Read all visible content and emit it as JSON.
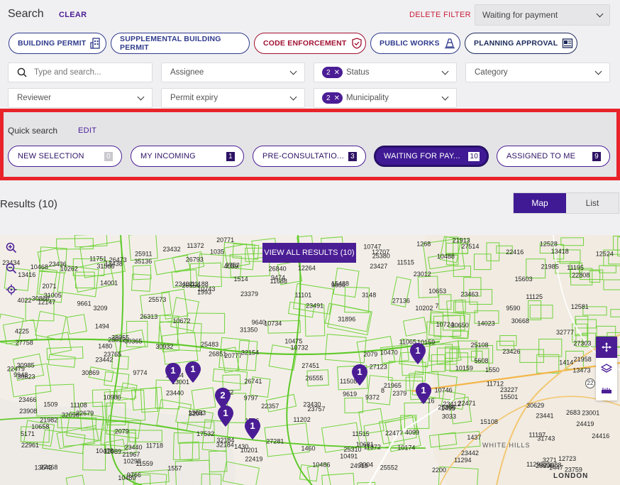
{
  "header": {
    "title": "Search",
    "clear": "CLEAR",
    "delete_filter": "DELETE FILTER",
    "saved_filter": "Waiting for payment"
  },
  "categories": [
    {
      "label": "BUILDING PERMIT",
      "icon": "building-icon"
    },
    {
      "label": "SUPPLEMENTAL BUILDING PERMIT",
      "icon": ""
    },
    {
      "label": "CODE ENFORCEMENT",
      "icon": "shield-check-icon"
    },
    {
      "label": "PUBLIC WORKS",
      "icon": "cone-icon"
    },
    {
      "label": "PLANNING APPROVAL",
      "icon": "map-icon"
    }
  ],
  "filters": {
    "search_placeholder": "Type and search...",
    "assignee": "Assignee",
    "status": {
      "count": "2",
      "label": "Status"
    },
    "category": "Category",
    "reviewer": "Reviewer",
    "permit_expiry": "Permit expiry",
    "municipality": {
      "count": "2",
      "label": "Municipality"
    }
  },
  "quick_search": {
    "title": "Quick search",
    "edit": "EDIT",
    "items": [
      {
        "label": "NEW SELECTION",
        "count": "0"
      },
      {
        "label": "MY INCOMING",
        "count": "1"
      },
      {
        "label": "PRE-CONSULTATIO...",
        "count": "3"
      },
      {
        "label": "WAITING FOR PAY...",
        "count": "10",
        "active": true
      },
      {
        "label": "ASSIGNED TO ME",
        "count": "9"
      }
    ]
  },
  "results": {
    "label": "Results (10)",
    "view_map": "Map",
    "view_list": "List"
  },
  "map": {
    "view_all": "VIEW ALL RESULTS (10)",
    "markers": [
      "1",
      "1",
      "1",
      "1",
      "1",
      "1",
      "2",
      "1",
      "1"
    ],
    "places": {
      "white_hills": "WHITE HILLS",
      "london": "LONDON"
    },
    "road_badge": "22",
    "parcel_numbers": [
      "1993",
      "32777",
      "27136",
      "27303",
      "20777",
      "2683",
      "12072",
      "1268",
      "23441",
      "15603",
      "26313",
      "23227",
      "14023",
      "3204",
      "32090",
      "27451",
      "27254",
      "4225",
      "11372",
      "11688",
      "12723",
      "15488",
      "32089",
      "10986",
      "31896",
      "27514",
      "27468",
      "4099",
      "24919",
      "11195",
      "11559",
      "23759",
      "23442",
      "2322",
      "28055",
      "27758",
      "21958",
      "8",
      "11125",
      "11712",
      "25552",
      "12147",
      "22357",
      "23757",
      "31743",
      "31566",
      "3148",
      "7",
      "11188",
      "11718",
      "11293",
      "25573",
      "11294",
      "23012",
      "23440",
      "11202",
      "11101",
      "23412",
      "22471",
      "27123",
      "23001",
      "13418",
      "31350",
      "26793",
      "23402",
      "13438",
      "23436",
      "30365",
      "23432",
      "23427",
      "23434",
      "30985",
      "30932",
      "22479",
      "23442",
      "25483",
      "10495",
      "23426",
      "23012",
      "12524",
      "11508",
      "22679",
      "22477",
      "13001",
      "23430",
      "15501",
      "17532",
      "2379",
      "23088",
      "30823",
      "3271",
      "10489",
      "10653",
      "10681",
      "13416",
      "10488",
      "10658",
      "3033",
      "32154",
      "10747",
      "11515",
      "21982",
      "3004",
      "30869",
      "30866",
      "32184",
      "10732",
      "10202",
      "25911",
      "10468",
      "10743",
      "10486",
      "10478",
      "10672",
      "11515",
      "11751",
      "12528",
      "21913",
      "1035",
      "26555",
      "32184",
      "10262",
      "10734",
      "25386",
      "10746",
      "23466",
      "23440",
      "10491",
      "11372",
      "11108",
      "12581",
      "23491",
      "5608",
      "35136",
      "31005",
      "9619",
      "9716",
      "25380",
      "25108",
      "10724",
      "12264",
      "23463",
      "10470",
      "23908",
      "30668",
      "30650",
      "9886",
      "9752",
      "9640",
      "10201",
      "10174",
      "24419",
      "21985",
      "13642",
      "2200",
      "23379",
      "30629",
      "4022",
      "9774",
      "10475",
      "9766",
      "10159",
      "23765",
      "2079",
      "14001",
      "26554",
      "4050",
      "22808",
      "21967",
      "4089",
      "9797",
      "10298",
      "22419",
      "22416",
      "21965",
      "24416",
      "9372",
      "9590",
      "9474",
      "5171",
      "3209",
      "9661",
      "27281",
      "28899",
      "26851",
      "26473",
      "26741",
      "26840",
      "25310",
      "9948",
      "10159",
      "13473",
      "2071",
      "12707",
      "11065",
      "11197",
      "20771",
      "22961",
      "15108",
      "13653",
      "1514",
      "1494",
      "1550",
      "1509",
      "1557",
      "2079",
      "1526",
      "1460",
      "1437",
      "1495",
      "1480",
      "1447",
      "1430",
      "1376",
      "1414"
    ]
  }
}
